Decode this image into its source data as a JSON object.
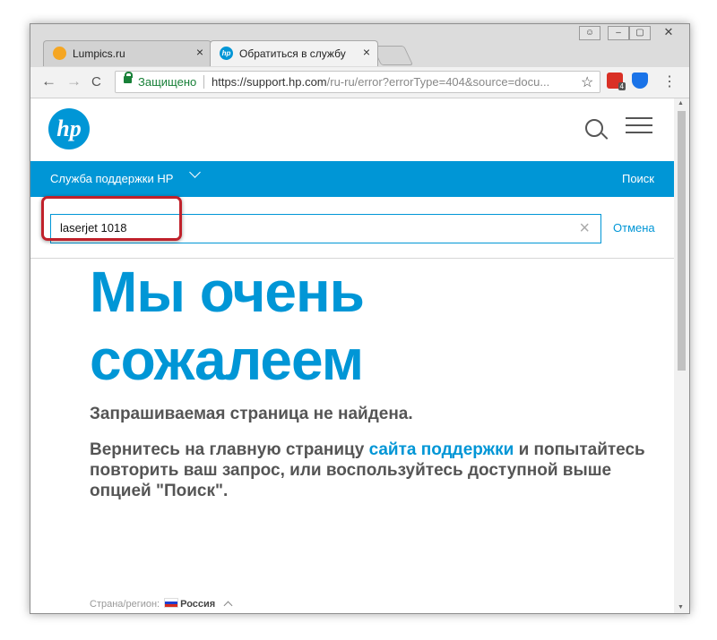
{
  "browser": {
    "tabs": [
      {
        "title": "Lumpics.ru",
        "active": false,
        "favicon": "lumpics-favicon",
        "favicon_color": "#f5a623"
      },
      {
        "title": "Обратиться в службу по",
        "active": true,
        "favicon": "hp-favicon",
        "favicon_color": "#0096d6"
      }
    ],
    "close_glyph": "×",
    "window_controls": [
      "person-icon",
      "minimize-icon",
      "maximize-icon",
      "close-icon"
    ],
    "nav": {
      "back_glyph": "←",
      "forward_glyph": "→",
      "reload_glyph": "C"
    },
    "address": {
      "secure_label": "Защищено",
      "url_main": "https://support.hp.com",
      "url_rest": "/ru-ru/error?errorType=404&source=docu..."
    },
    "star_glyph": "☆",
    "extensions": [
      {
        "name": "adblock-extension-icon",
        "color": "#d93025",
        "badge": "4"
      },
      {
        "name": "shield-extension-icon",
        "color": "#1a73e8"
      }
    ],
    "menu_glyph": "⋮"
  },
  "site": {
    "logo_text": "hp",
    "brand_color": "#0096d6",
    "support_menu_label": "Служба поддержки HP",
    "search_link_label": "Поиск",
    "search_value": "laserjet 1018",
    "clear_glyph": "×",
    "cancel_label": "Отмена",
    "heading_line1": "Мы очень",
    "heading_line2": "сожалеем",
    "not_found_text": "Запрашиваемая страница не найдена.",
    "desc_part1": "Вернитесь на главную страницу ",
    "desc_link": "сайта поддержки",
    "desc_part2": " и попытайтесь повторить ваш запрос, или воспользуйтесь доступной выше опцией \"Поиск\".",
    "country_label": "Страна/регион:",
    "country_value": "Россия"
  },
  "annotation": {
    "highlight_color": "#c0212b"
  }
}
